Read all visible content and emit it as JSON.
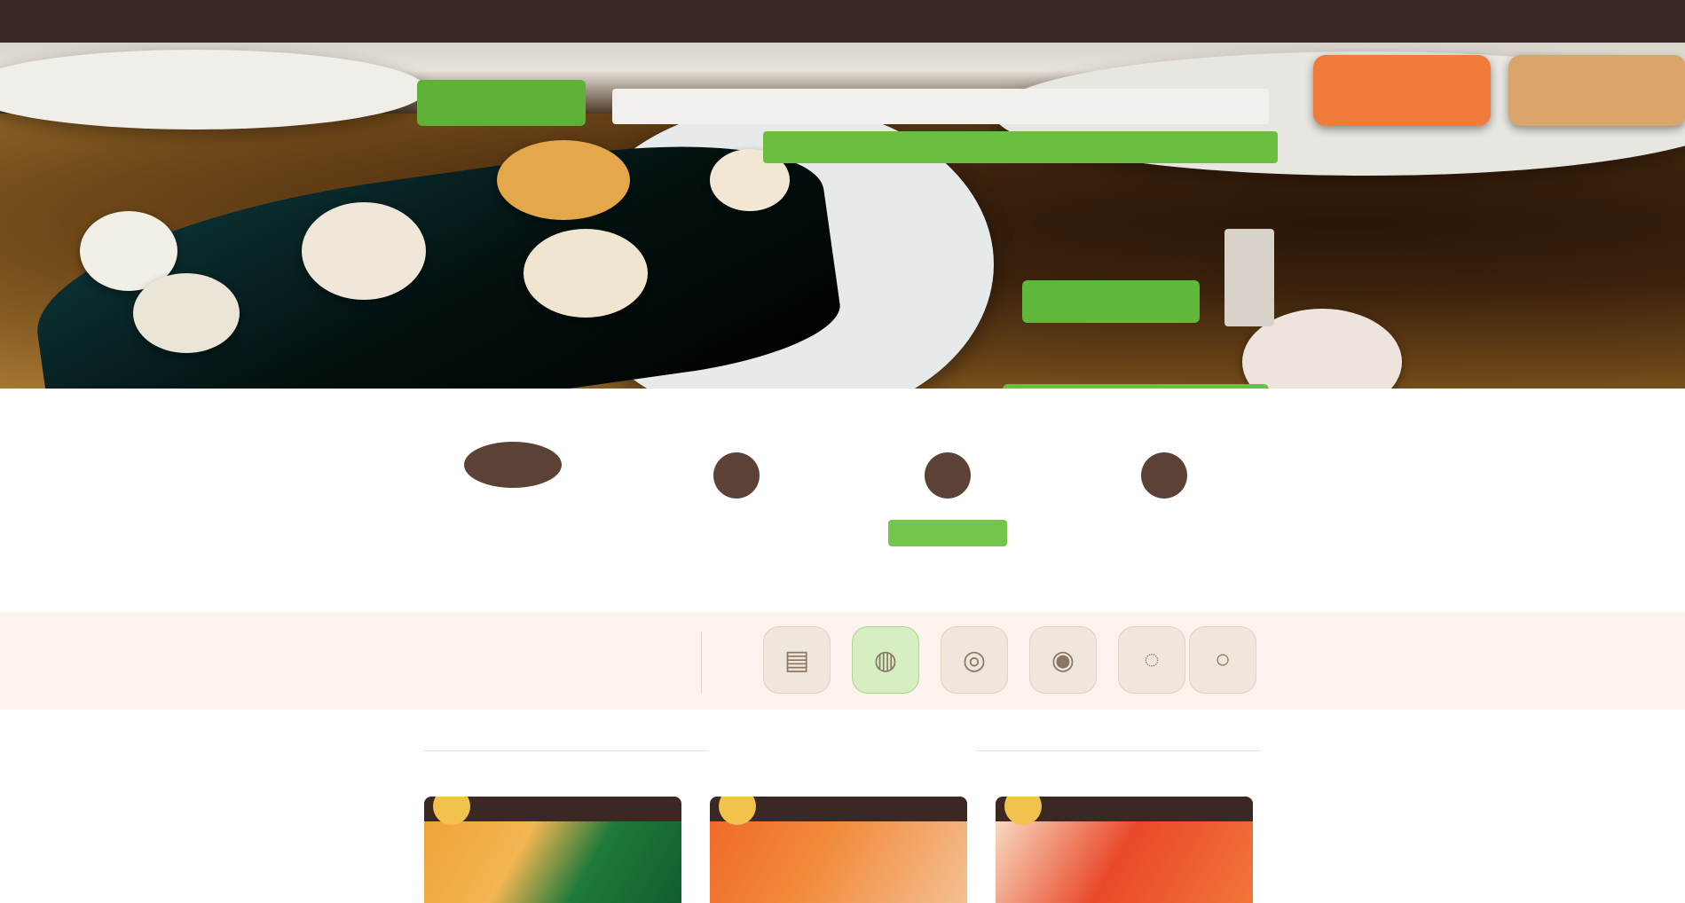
{
  "header": {
    "nav": [
      "",
      "",
      "",
      "",
      "",
      ""
    ]
  },
  "hero": {
    "promo_text": "",
    "promo_button": ""
  },
  "steps": {
    "title": "",
    "items": [
      {
        "text": ""
      },
      {
        "text": ""
      },
      {
        "text": "",
        "button": ""
      },
      {
        "text": ""
      }
    ]
  },
  "filter": {
    "label": "",
    "options": [
      {
        "icon": "all-icon",
        "glyph": "▤"
      },
      {
        "icon": "sushi-icon",
        "glyph": "◍"
      },
      {
        "icon": "roll-icon",
        "glyph": "◎"
      },
      {
        "icon": "set-icon",
        "glyph": "◉"
      },
      {
        "icon": "drink-icon",
        "glyph": "◌"
      },
      {
        "icon": "dessert-icon",
        "glyph": "○"
      }
    ],
    "active_index": 1
  },
  "products": {
    "title": ""
  },
  "colors": {
    "accent_green": "#5fb83a",
    "brown_dark": "#3a2a26",
    "band_bg": "#fbf3ec"
  }
}
